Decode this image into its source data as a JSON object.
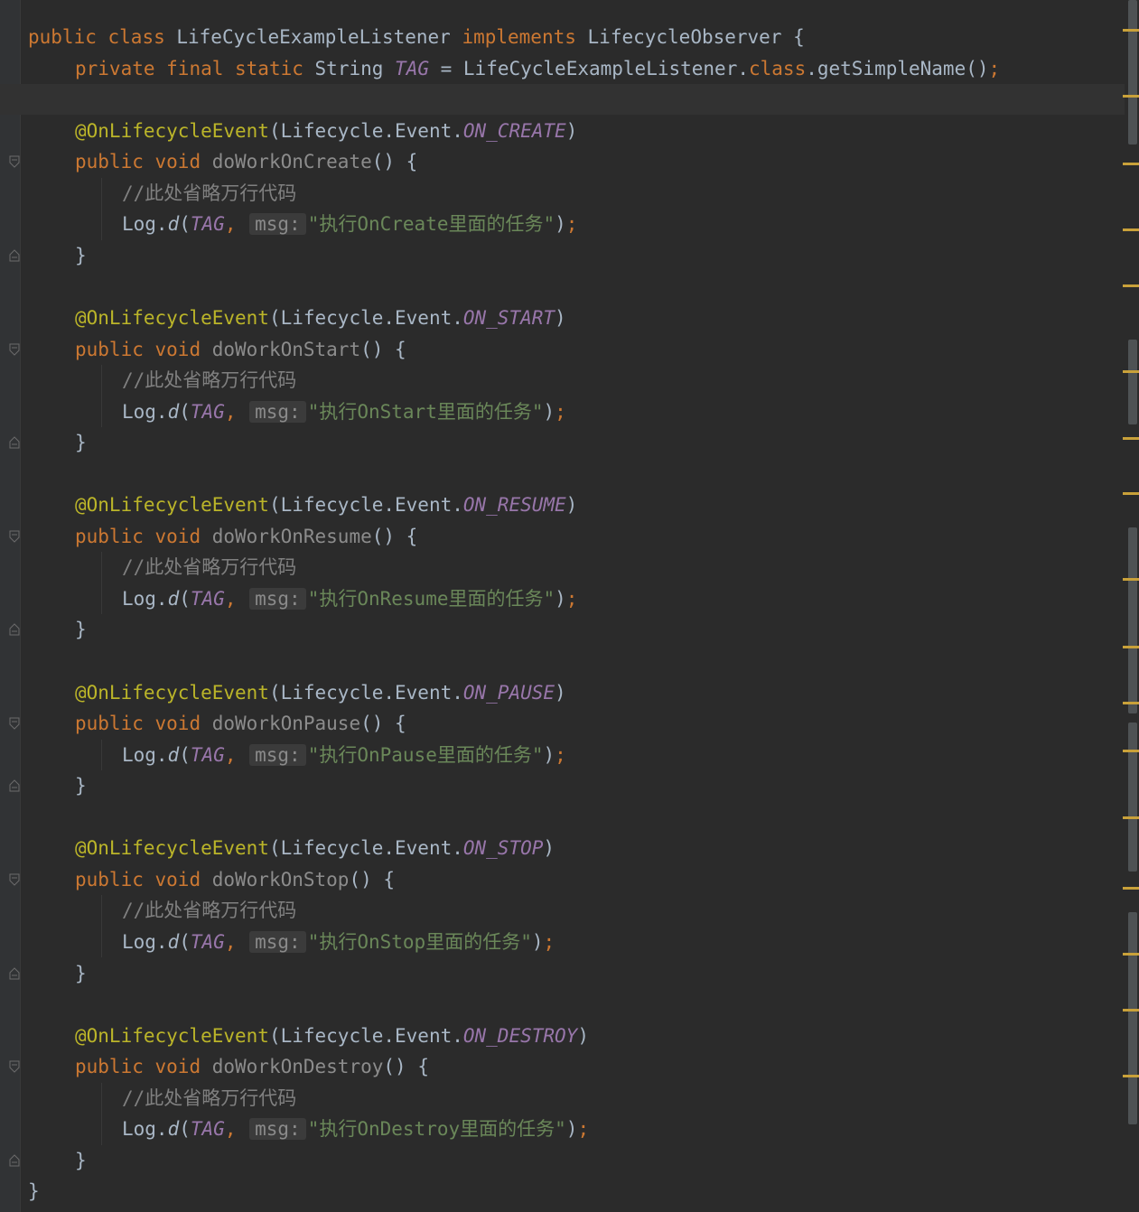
{
  "editor": {
    "lines": [
      {
        "indent": 0,
        "tokens": [
          [
            "kw",
            "public "
          ],
          [
            "kw",
            "class "
          ],
          [
            "cls",
            "LifeCycleExampleListener "
          ],
          [
            "kw",
            "implements "
          ],
          [
            "cls",
            "LifecycleObserver {"
          ]
        ]
      },
      {
        "indent": 1,
        "tokens": [
          [
            "kw",
            "private "
          ],
          [
            "kw",
            "final "
          ],
          [
            "kw",
            "static "
          ],
          [
            "cls",
            "String "
          ],
          [
            "sfld",
            "TAG"
          ],
          [
            "cls",
            " = LifeCycleExampleListener."
          ],
          [
            "kw",
            "class"
          ],
          [
            "cls",
            ".getSimpleName()"
          ],
          [
            "semi",
            ";"
          ]
        ]
      },
      {
        "indent": 1,
        "current": true,
        "tokens": []
      },
      {
        "indent": 1,
        "tokens": [
          [
            "ann",
            "@OnLifecycleEvent"
          ],
          [
            "cls",
            "(Lifecycle.Event."
          ],
          [
            "fld",
            "ON_CREATE"
          ],
          [
            "cls",
            ")"
          ]
        ]
      },
      {
        "indent": 1,
        "fold": "open",
        "tokens": [
          [
            "kw",
            "public "
          ],
          [
            "kw",
            "void "
          ],
          [
            "unused",
            "doWorkOnCreate"
          ],
          [
            "cls",
            "() {"
          ]
        ]
      },
      {
        "indent": 2,
        "tokens": [
          [
            "cmt",
            "//此处省略万行代码"
          ]
        ]
      },
      {
        "indent": 2,
        "tokens": [
          [
            "cls",
            "Log."
          ],
          [
            "stmth",
            "d"
          ],
          [
            "cls",
            "("
          ],
          [
            "sfld",
            "TAG"
          ],
          [
            "semi",
            ", "
          ],
          [
            "hint",
            "msg:"
          ],
          [
            "str",
            "\"执行OnCreate里面的任务\""
          ],
          [
            "cls",
            ")"
          ],
          [
            "semi",
            ";"
          ]
        ]
      },
      {
        "indent": 1,
        "fold": "close",
        "tokens": [
          [
            "cls",
            "}"
          ]
        ]
      },
      {
        "indent": 0,
        "tokens": []
      },
      {
        "indent": 1,
        "tokens": [
          [
            "ann",
            "@OnLifecycleEvent"
          ],
          [
            "cls",
            "(Lifecycle.Event."
          ],
          [
            "fld",
            "ON_START"
          ],
          [
            "cls",
            ")"
          ]
        ]
      },
      {
        "indent": 1,
        "fold": "open",
        "tokens": [
          [
            "kw",
            "public "
          ],
          [
            "kw",
            "void "
          ],
          [
            "unused",
            "doWorkOnStart"
          ],
          [
            "cls",
            "() {"
          ]
        ]
      },
      {
        "indent": 2,
        "tokens": [
          [
            "cmt",
            "//此处省略万行代码"
          ]
        ]
      },
      {
        "indent": 2,
        "tokens": [
          [
            "cls",
            "Log."
          ],
          [
            "stmth",
            "d"
          ],
          [
            "cls",
            "("
          ],
          [
            "sfld",
            "TAG"
          ],
          [
            "semi",
            ", "
          ],
          [
            "hint",
            "msg:"
          ],
          [
            "str",
            "\"执行OnStart里面的任务\""
          ],
          [
            "cls",
            ")"
          ],
          [
            "semi",
            ";"
          ]
        ]
      },
      {
        "indent": 1,
        "fold": "close",
        "tokens": [
          [
            "cls",
            "}"
          ]
        ]
      },
      {
        "indent": 0,
        "tokens": []
      },
      {
        "indent": 1,
        "tokens": [
          [
            "ann",
            "@OnLifecycleEvent"
          ],
          [
            "cls",
            "(Lifecycle.Event."
          ],
          [
            "fld",
            "ON_RESUME"
          ],
          [
            "cls",
            ")"
          ]
        ]
      },
      {
        "indent": 1,
        "fold": "open",
        "tokens": [
          [
            "kw",
            "public "
          ],
          [
            "kw",
            "void "
          ],
          [
            "unused",
            "doWorkOnResume"
          ],
          [
            "cls",
            "() {"
          ]
        ]
      },
      {
        "indent": 2,
        "tokens": [
          [
            "cmt",
            "//此处省略万行代码"
          ]
        ]
      },
      {
        "indent": 2,
        "tokens": [
          [
            "cls",
            "Log."
          ],
          [
            "stmth",
            "d"
          ],
          [
            "cls",
            "("
          ],
          [
            "sfld",
            "TAG"
          ],
          [
            "semi",
            ", "
          ],
          [
            "hint",
            "msg:"
          ],
          [
            "str",
            "\"执行OnResume里面的任务\""
          ],
          [
            "cls",
            ")"
          ],
          [
            "semi",
            ";"
          ]
        ]
      },
      {
        "indent": 1,
        "fold": "close",
        "tokens": [
          [
            "cls",
            "}"
          ]
        ]
      },
      {
        "indent": 0,
        "tokens": []
      },
      {
        "indent": 1,
        "tokens": [
          [
            "ann",
            "@OnLifecycleEvent"
          ],
          [
            "cls",
            "(Lifecycle.Event."
          ],
          [
            "fld",
            "ON_PAUSE"
          ],
          [
            "cls",
            ")"
          ]
        ]
      },
      {
        "indent": 1,
        "fold": "open",
        "tokens": [
          [
            "kw",
            "public "
          ],
          [
            "kw",
            "void "
          ],
          [
            "unused",
            "doWorkOnPause"
          ],
          [
            "cls",
            "() {"
          ]
        ]
      },
      {
        "indent": 2,
        "tokens": [
          [
            "cls",
            "Log."
          ],
          [
            "stmth",
            "d"
          ],
          [
            "cls",
            "("
          ],
          [
            "sfld",
            "TAG"
          ],
          [
            "semi",
            ", "
          ],
          [
            "hint",
            "msg:"
          ],
          [
            "str",
            "\"执行OnPause里面的任务\""
          ],
          [
            "cls",
            ")"
          ],
          [
            "semi",
            ";"
          ]
        ]
      },
      {
        "indent": 1,
        "fold": "close",
        "tokens": [
          [
            "cls",
            "}"
          ]
        ]
      },
      {
        "indent": 0,
        "tokens": []
      },
      {
        "indent": 1,
        "tokens": [
          [
            "ann",
            "@OnLifecycleEvent"
          ],
          [
            "cls",
            "(Lifecycle.Event."
          ],
          [
            "fld",
            "ON_STOP"
          ],
          [
            "cls",
            ")"
          ]
        ]
      },
      {
        "indent": 1,
        "fold": "open",
        "tokens": [
          [
            "kw",
            "public "
          ],
          [
            "kw",
            "void "
          ],
          [
            "unused",
            "doWorkOnStop"
          ],
          [
            "cls",
            "() {"
          ]
        ]
      },
      {
        "indent": 2,
        "tokens": [
          [
            "cmt",
            "//此处省略万行代码"
          ]
        ]
      },
      {
        "indent": 2,
        "tokens": [
          [
            "cls",
            "Log."
          ],
          [
            "stmth",
            "d"
          ],
          [
            "cls",
            "("
          ],
          [
            "sfld",
            "TAG"
          ],
          [
            "semi",
            ", "
          ],
          [
            "hint",
            "msg:"
          ],
          [
            "str",
            "\"执行OnStop里面的任务\""
          ],
          [
            "cls",
            ")"
          ],
          [
            "semi",
            ";"
          ]
        ]
      },
      {
        "indent": 1,
        "fold": "close",
        "tokens": [
          [
            "cls",
            "}"
          ]
        ]
      },
      {
        "indent": 0,
        "tokens": []
      },
      {
        "indent": 1,
        "tokens": [
          [
            "ann",
            "@OnLifecycleEvent"
          ],
          [
            "cls",
            "(Lifecycle.Event."
          ],
          [
            "fld",
            "ON_DESTROY"
          ],
          [
            "cls",
            ")"
          ]
        ]
      },
      {
        "indent": 1,
        "fold": "open",
        "tokens": [
          [
            "kw",
            "public "
          ],
          [
            "kw",
            "void "
          ],
          [
            "unused",
            "doWorkOnDestroy"
          ],
          [
            "cls",
            "() {"
          ]
        ]
      },
      {
        "indent": 2,
        "tokens": [
          [
            "cmt",
            "//此处省略万行代码"
          ]
        ]
      },
      {
        "indent": 2,
        "tokens": [
          [
            "cls",
            "Log."
          ],
          [
            "stmth",
            "d"
          ],
          [
            "cls",
            "("
          ],
          [
            "sfld",
            "TAG"
          ],
          [
            "semi",
            ", "
          ],
          [
            "hint",
            "msg:"
          ],
          [
            "str",
            "\"执行OnDestroy里面的任务\""
          ],
          [
            "cls",
            ")"
          ],
          [
            "semi",
            ";"
          ]
        ]
      },
      {
        "indent": 1,
        "fold": "close",
        "tokens": [
          [
            "cls",
            "}"
          ]
        ]
      },
      {
        "indent": 0,
        "tokens": [
          [
            "cls",
            "}"
          ]
        ]
      }
    ]
  },
  "colors": {
    "background": "#2b2b2b",
    "keyword": "#cc7832",
    "annotation": "#bbb529",
    "field": "#9876aa",
    "string": "#6a8759",
    "comment": "#808080",
    "marker": "#c9a13a"
  }
}
